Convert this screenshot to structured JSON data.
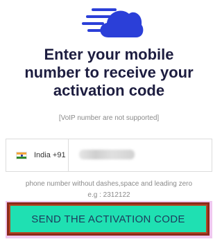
{
  "logo": {
    "icon": "cloud-speed-logo",
    "color": "#2b3fd8"
  },
  "heading": {
    "line1": "Enter your mobile",
    "line2": "number to receive your",
    "line3": "activation code"
  },
  "voip_note": "[VoIP number are not supported]",
  "country": {
    "flag": "india-flag",
    "label": "India +91"
  },
  "phone_input": {
    "value": "",
    "placeholder": ""
  },
  "hint": {
    "line1": "phone number without dashes,space and leading zero",
    "line2": "e.g : 2312122"
  },
  "send_button": {
    "label": "SEND THE ACTIVATION CODE",
    "color": "#1fe0b2"
  }
}
